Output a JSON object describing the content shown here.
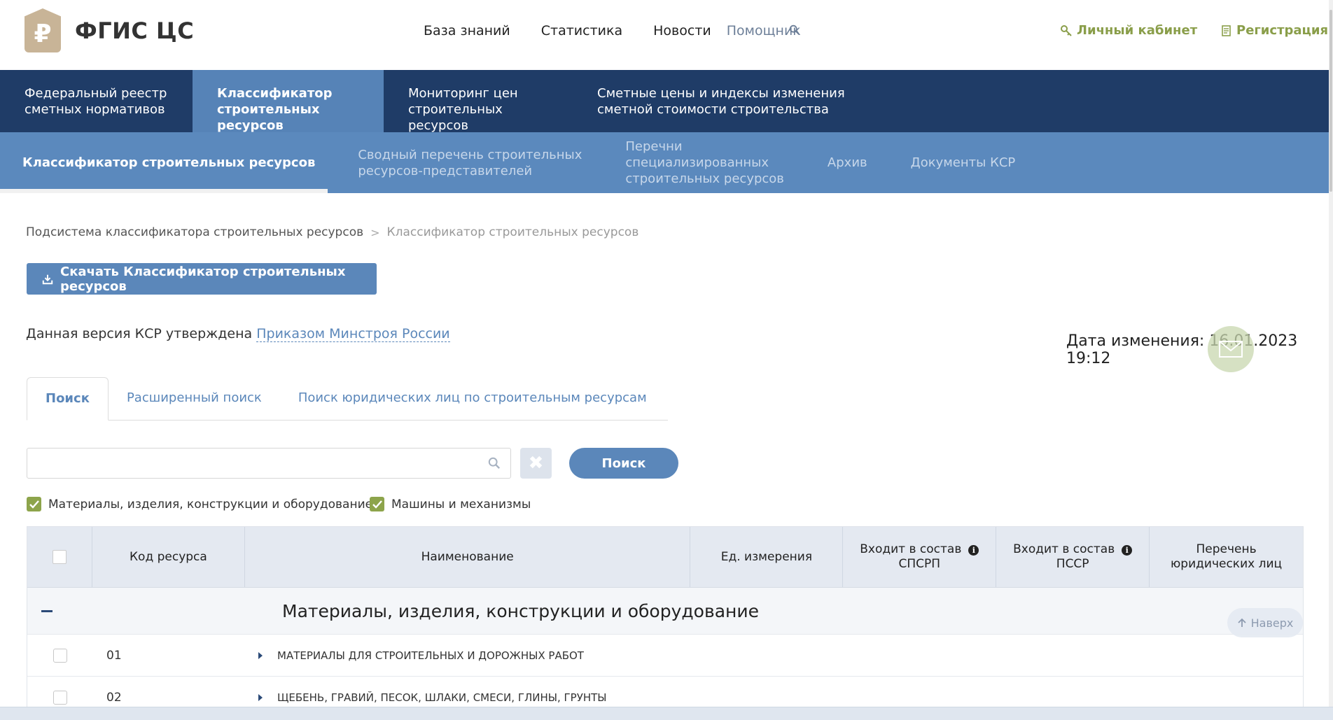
{
  "header": {
    "logo_symbol": "₽",
    "logo_text": "ФГИС ЦС",
    "nav": [
      "База знаний",
      "Статистика",
      "Новости",
      "Помощник"
    ],
    "account_label": "Личный кабинет",
    "register_label": "Регистрация"
  },
  "main_nav": [
    {
      "line1": "Федеральный реестр",
      "line2": "сметных нормативов"
    },
    {
      "line1": "Классификатор",
      "line2": "строительных ресурсов"
    },
    {
      "line1": "Мониторинг цен",
      "line2": "строительных ресурсов"
    },
    {
      "line1": "Сметные цены и индексы изменения",
      "line2": "сметной стоимости строительства"
    }
  ],
  "sub_nav": {
    "active": "Классификатор строительных ресурсов",
    "item2_line1": "Сводный перечень строительных",
    "item2_line2": "ресурсов-представителей",
    "item3_line1": "Перечни",
    "item3_line2": "специализированных",
    "item3_line3": "строительных ресурсов",
    "item4": "Архив",
    "item5": "Документы КСР"
  },
  "breadcrumb": {
    "parent": "Подсистема классификатора строительных ресурсов",
    "sep": ">",
    "current": "Классификатор строительных ресурсов"
  },
  "download_label": "Скачать Классификатор строительных ресурсов",
  "approved": {
    "text": "Данная версия КСР утверждена",
    "link": "Приказом Минстроя России"
  },
  "change_date": "Дата изменения: 16.01.2023 19:12",
  "tabs": [
    "Поиск",
    "Расширенный поиск",
    "Поиск юридических лиц по строительным ресурсам"
  ],
  "search": {
    "placeholder": "",
    "button_label": "Поиск",
    "clear_symbol": "✖"
  },
  "filters": [
    "Материалы, изделия, конструкции и оборудование",
    "Машины и механизмы"
  ],
  "table": {
    "headers": {
      "code": "Код ресурса",
      "name": "Наименование",
      "unit": "Ед. измерения",
      "spsrp_line1": "Входит в состав",
      "spsrp_line2": "СПСРП",
      "pssr_line1": "Входит в состав",
      "pssr_line2": "ПССР",
      "legal_line1": "Перечень",
      "legal_line2": "юридических лиц"
    },
    "group_title": "Материалы, изделия, конструкции и оборудование",
    "rows": [
      {
        "code": "01",
        "name": "МАТЕРИАЛЫ ДЛЯ СТРОИТЕЛЬНЫХ И ДОРОЖНЫХ РАБОТ"
      },
      {
        "code": "02",
        "name": "ЩЕБЕНЬ, ГРАВИЙ, ПЕСОК, ШЛАКИ, СМЕСИ, ГЛИНЫ, ГРУНТЫ"
      }
    ]
  },
  "to_top_label": "Наверх",
  "colors": {
    "nav_dark": "#1f3c67",
    "nav_active": "#5683b7",
    "sub_nav": "#5b89bd",
    "accent_green": "#8a9e4a",
    "button_blue": "#5b87ba"
  }
}
